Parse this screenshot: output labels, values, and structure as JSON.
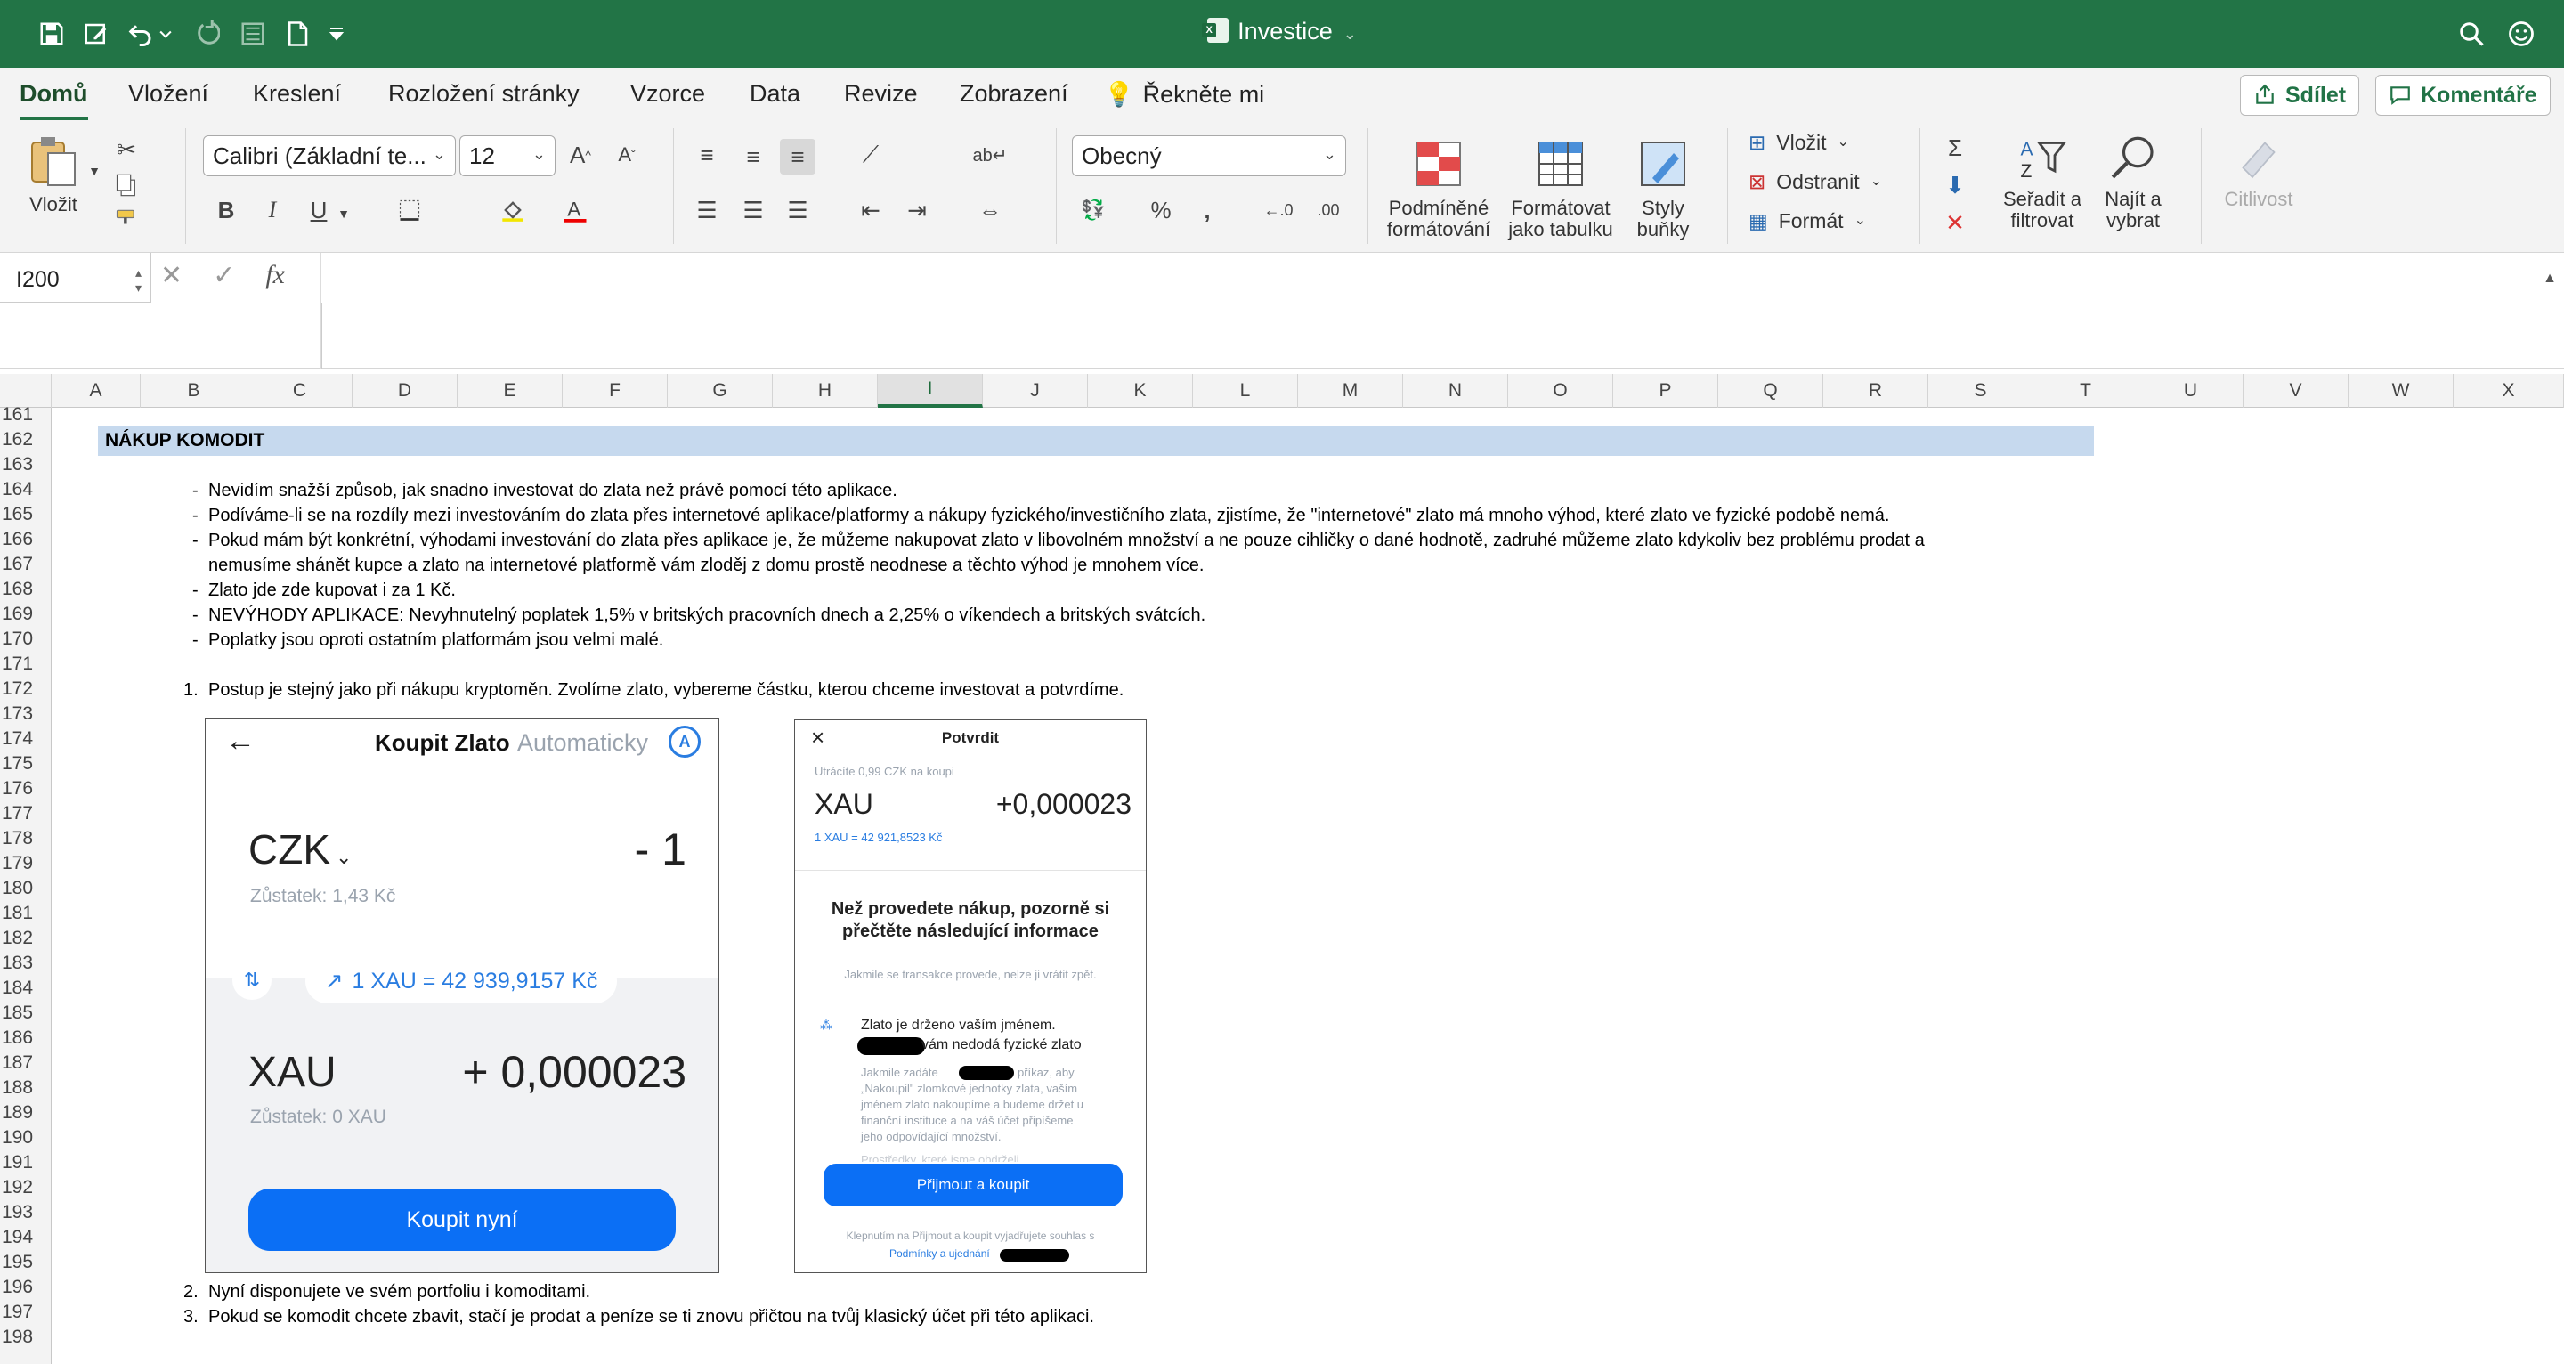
{
  "window": {
    "title": "Investice"
  },
  "tabs": [
    "Domů",
    "Vložení",
    "Kreslení",
    "Rozložení stránky",
    "Vzorce",
    "Data",
    "Revize",
    "Zobrazení",
    "Řekněte mi"
  ],
  "share": {
    "share_label": "Sdílet",
    "comments_label": "Komentáře"
  },
  "ribbon": {
    "paste_label": "Vložit",
    "font_name": "Calibri (Základní te...",
    "font_size": "12",
    "number_format": "Obecný",
    "conditional_formatting": [
      "Podmíněné",
      "formátování"
    ],
    "format_as_table": [
      "Formátovat",
      "jako tabulku"
    ],
    "cell_styles": [
      "Styly",
      "buňky"
    ],
    "insert_label": "Vložit",
    "delete_label": "Odstranit",
    "format_label": "Formát",
    "sort_filter": [
      "Seřadit a",
      "filtrovat"
    ],
    "find_select": [
      "Najít a",
      "vybrat"
    ],
    "sensitivity_label": "Citlivost",
    "bold": "B",
    "italic": "I",
    "underline": "U"
  },
  "formula_bar": {
    "name_box": "I200",
    "fx": "fx",
    "formula": ""
  },
  "columns": [
    "A",
    "B",
    "C",
    "D",
    "E",
    "F",
    "G",
    "H",
    "I",
    "J",
    "K",
    "L",
    "M",
    "N",
    "O",
    "P",
    "Q",
    "R",
    "S",
    "T",
    "U",
    "V",
    "W",
    "X"
  ],
  "selected_column": "I",
  "rows": [
    "161",
    "162",
    "163",
    "164",
    "165",
    "166",
    "167",
    "168",
    "169",
    "170",
    "171",
    "172",
    "173",
    "174",
    "175",
    "176",
    "177",
    "178",
    "179",
    "180",
    "181",
    "182",
    "183",
    "184",
    "185",
    "186",
    "187",
    "188",
    "189",
    "190",
    "191",
    "192",
    "193",
    "194",
    "195",
    "196",
    "197",
    "198"
  ],
  "sheet": {
    "heading": "NÁKUP KOMODIT",
    "bullets": [
      "Nevidím snažší způsob, jak snadno investovat do zlata než právě pomocí této aplikace.",
      "Podíváme-li se na rozdíly mezi investováním do zlata přes internetové aplikace/platformy a nákupy fyzického/investičního zlata, zjistíme, že \"internetové\" zlato má mnoho výhod, které zlato ve fyzické podobě nemá.",
      "Pokud mám být konkrétní, výhodami investování do zlata přes aplikace je, že můžeme nakupovat zlato v libovolném množství a ne pouze cihličky o dané hodnotě, zadruhé můžeme zlato kdykoliv bez problému prodat a",
      "nemusíme shánět kupce a zlato na internetové platformě vám zloděj z domu prostě neodnese a těchto výhod je mnohem více.",
      "Zlato jde zde kupovat i za 1 Kč.",
      "NEVÝHODY APLIKACE: Nevyhnutelný poplatek 1,5% v britských pracovních dnech a 2,25% o víkendech a britských svátcích.",
      "Poplatky jsou oproti ostatním platformám jsou velmi malé."
    ],
    "steps": [
      {
        "n": "1.",
        "text": "Postup je stejný jako při nákupu kryptoměn. Zvolíme zlato, vybereme částku, kterou chceme investovat a potvrdíme."
      },
      {
        "n": "2.",
        "text": "Nyní disponujete ve svém portfoliu i komoditami."
      },
      {
        "n": "3.",
        "text": "Pokud se komodit chcete zbavit, stačí je prodat a peníze se ti znovu přičtou na tvůj klasický účet při této aplikaci."
      }
    ]
  },
  "phone1": {
    "title": "Koupit Zlato",
    "mode": "Automaticky",
    "currency": "CZK",
    "amount": "- 1",
    "balance_czk": "Zůstatek: 1,43 Kč",
    "rate": "1 XAU = 42 939,9157 Kč",
    "asset": "XAU",
    "asset_amount": "+ 0,000023",
    "balance_xau": "Zůstatek: 0 XAU",
    "button": "Koupit nyní"
  },
  "phone2": {
    "title": "Potvrdit",
    "spend": "Utrácíte 0,99  CZK na koupi",
    "asset": "XAU",
    "asset_amount": "+0,000023",
    "rate": "1 XAU = 42 921,8523 Kč",
    "notice_title": "Než provedete nákup, pozorně si přečtěte následující informace",
    "notice_sub": "Jakmile se transakce provede, nelze ji vrátit zpět.",
    "info_title": "Zlato je drženo vaším jménem.",
    "info_title2": "vám nedodá fyzické zlato",
    "info_body_1": "Jakmile zadáte",
    "info_body_1b": "příkaz, aby",
    "info_body_2": "„Nakoupil\" zlomkové jednotky zlata, vaším",
    "info_body_3": "jménem zlato nakoupíme a budeme držet u",
    "info_body_4": "finanční instituce a na váš účet připíšeme",
    "info_body_5": "jeho odpovídající množství.",
    "info_cut": "Prostředky, které jsme obdrželi",
    "button": "Přijmout a koupit",
    "terms": "Klepnutím na Přijmout a koupit vyjadřujete souhlas s",
    "terms_link": "Podmínky a ujednání"
  },
  "colors": {
    "excel_green": "#227446",
    "heading_fill": "#c6d9ee",
    "accent_blue": "#0b6ff5"
  }
}
